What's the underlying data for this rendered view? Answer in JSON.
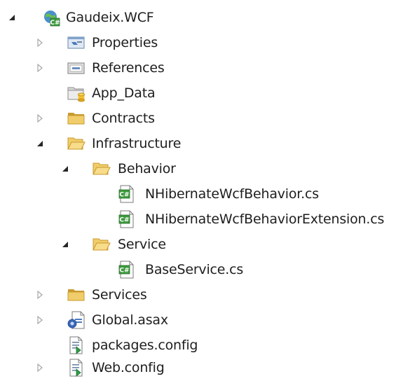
{
  "tree": {
    "project": {
      "label": "Gaudeix.WCF",
      "icon": "csharp-project-icon",
      "expanded": true
    },
    "properties": {
      "label": "Properties",
      "icon": "properties-icon",
      "expanded": false
    },
    "references": {
      "label": "References",
      "icon": "references-icon",
      "expanded": false
    },
    "app_data": {
      "label": "App_Data",
      "icon": "database-folder-icon"
    },
    "contracts": {
      "label": "Contracts",
      "icon": "folder-icon",
      "expanded": false
    },
    "infrastructure": {
      "label": "Infrastructure",
      "icon": "folder-open-icon",
      "expanded": true
    },
    "behavior": {
      "label": "Behavior",
      "icon": "folder-open-icon",
      "expanded": true
    },
    "behavior_file1": {
      "label": "NHibernateWcfBehavior.cs",
      "icon": "csharp-file-icon"
    },
    "behavior_file2": {
      "label": "NHibernateWcfBehaviorExtension.cs",
      "icon": "csharp-file-icon"
    },
    "service": {
      "label": "Service",
      "icon": "folder-open-icon",
      "expanded": true
    },
    "service_file1": {
      "label": "BaseService.cs",
      "icon": "csharp-file-icon"
    },
    "services": {
      "label": "Services",
      "icon": "folder-icon",
      "expanded": false
    },
    "global_asax": {
      "label": "Global.asax",
      "icon": "global-asax-icon",
      "expanded": false
    },
    "packages_config": {
      "label": "packages.config",
      "icon": "config-file-icon"
    },
    "web_config": {
      "label": "Web.config",
      "icon": "config-file-icon",
      "expanded": false
    }
  },
  "colors": {
    "folder": "#e8c35a",
    "folder_dark": "#c99a2e",
    "arrow_collapsed": "#a6a6a6",
    "arrow_expanded": "#262626"
  }
}
